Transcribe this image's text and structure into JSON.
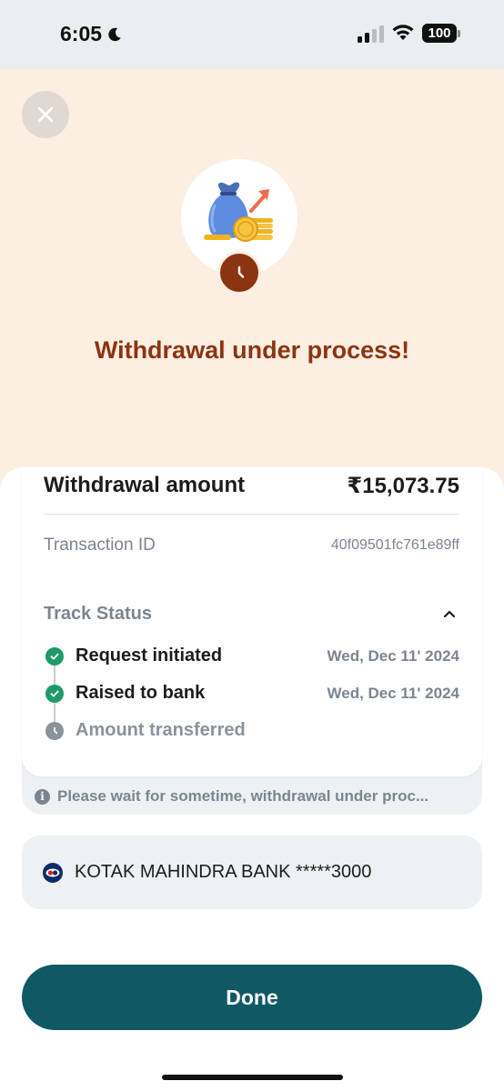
{
  "status_bar": {
    "time": "6:05",
    "battery": "100"
  },
  "hero": {
    "title": "Withdrawal under process!"
  },
  "summary": {
    "amount_label": "Withdrawal amount",
    "amount_value": "₹15,073.75",
    "transaction_label": "Transaction ID",
    "transaction_value": "40f09501fc761e89ff"
  },
  "track": {
    "title": "Track Status",
    "steps": [
      {
        "label": "Request initiated",
        "date": "Wed, Dec 11' 2024"
      },
      {
        "label": "Raised to bank",
        "date": "Wed, Dec 11' 2024"
      },
      {
        "label": "Amount transferred",
        "date": ""
      }
    ]
  },
  "info_note": "Please wait for sometime, withdrawal under proc...",
  "bank": {
    "name": "KOTAK MAHINDRA BANK *****3000"
  },
  "done_label": "Done",
  "colors": {
    "hero_bg": "#fdeee2",
    "title_brown": "#8b3510",
    "success_green": "#1e9a6a",
    "primary_button": "#0f5963"
  }
}
